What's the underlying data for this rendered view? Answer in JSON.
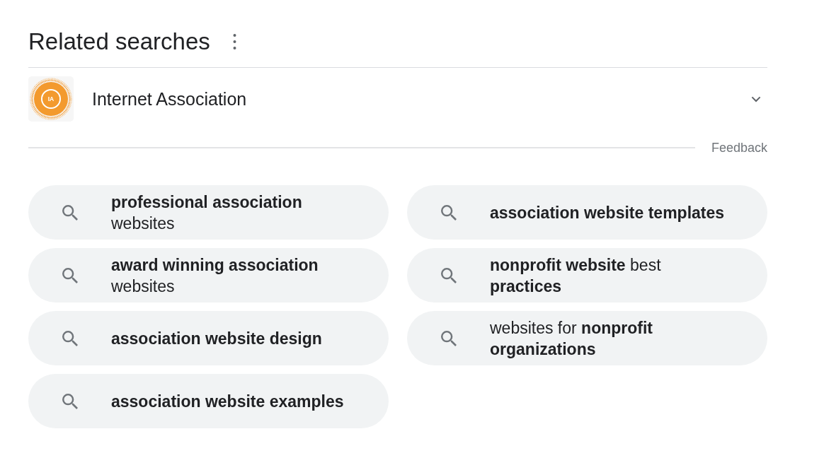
{
  "header": {
    "title": "Related searches"
  },
  "entity": {
    "name": "Internet Association",
    "logo_text": "IA",
    "expanded": false
  },
  "feedback": {
    "label": "Feedback"
  },
  "suggestion_columns": [
    {
      "items": [
        {
          "text": "**professional association** websites"
        },
        {
          "text": "**award winning association** websites"
        },
        {
          "text": "**association website design**"
        },
        {
          "text": "**association website examples**"
        }
      ]
    },
    {
      "items": [
        {
          "text": "**association website templates**"
        },
        {
          "text": "**nonprofit website** best **practices**"
        },
        {
          "text": "websites for **nonprofit organizations**"
        }
      ]
    }
  ]
}
